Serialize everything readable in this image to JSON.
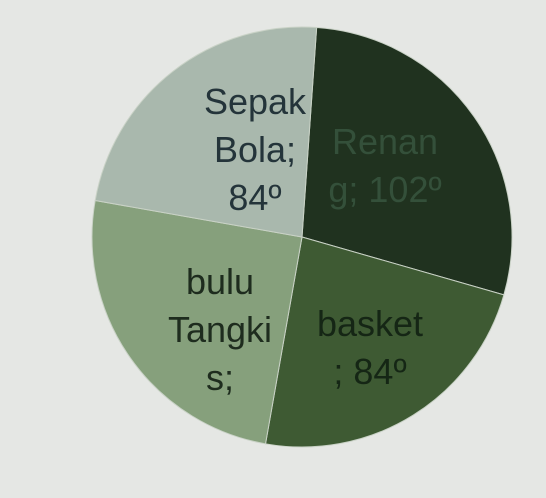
{
  "chart_data": {
    "type": "pie",
    "unit": "degrees",
    "slices": [
      {
        "label": "Sepak\nBola;\n84º",
        "name": "Sepak Bola",
        "value": 84,
        "color": "#a9b8ad"
      },
      {
        "label": "Renan\ng; 102º",
        "name": "Renang",
        "value": 102,
        "color": "#20321f"
      },
      {
        "label": "basket\n; 84º",
        "name": "basket",
        "value": 84,
        "color": "#3e5a33"
      },
      {
        "label": "bulu\nTangki\ns;",
        "name": "bulu Tangkis",
        "value": 90,
        "color": "#86a07c"
      }
    ]
  }
}
